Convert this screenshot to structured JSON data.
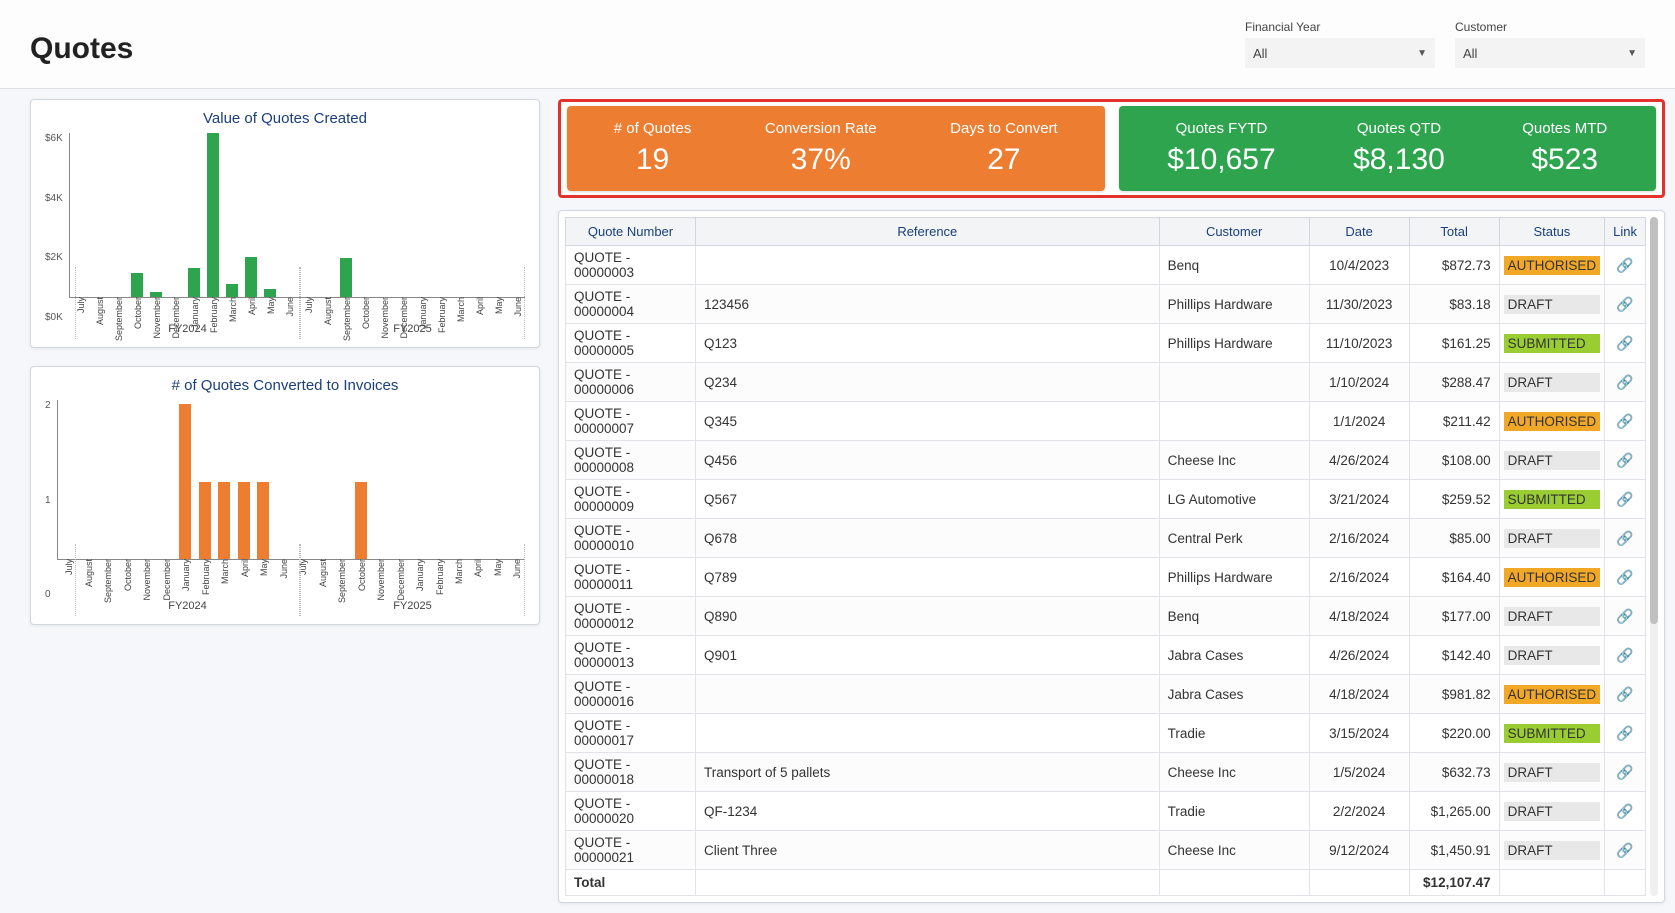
{
  "page_title": "Quotes",
  "filters": {
    "fy": {
      "label": "Financial Year",
      "value": "All"
    },
    "customer": {
      "label": "Customer",
      "value": "All"
    }
  },
  "kpi": {
    "orange": [
      {
        "label": "# of Quotes",
        "value": "19"
      },
      {
        "label": "Conversion Rate",
        "value": "37%"
      },
      {
        "label": "Days to Convert",
        "value": "27"
      }
    ],
    "green": [
      {
        "label": "Quotes FYTD",
        "value": "$10,657"
      },
      {
        "label": "Quotes QTD",
        "value": "$8,130"
      },
      {
        "label": "Quotes MTD",
        "value": "$523"
      }
    ]
  },
  "chart_data": [
    {
      "type": "bar",
      "title": "Value of Quotes Created",
      "ylabel": "",
      "ylim": [
        0,
        6000
      ],
      "y_ticks": [
        "$6K",
        "$4K",
        "$2K",
        "$0K"
      ],
      "groups": [
        "FY2024",
        "FY2025"
      ],
      "categories": [
        "July",
        "August",
        "September",
        "October",
        "November",
        "December",
        "January",
        "February",
        "March",
        "April",
        "May",
        "June"
      ],
      "series": [
        {
          "name": "FY2024",
          "color": "green",
          "values": [
            0,
            0,
            0,
            900,
            200,
            0,
            1100,
            6400,
            500,
            1500,
            300,
            0
          ]
        },
        {
          "name": "FY2025",
          "color": "green",
          "values": [
            0,
            0,
            1450,
            0,
            0,
            0,
            0,
            0,
            0,
            0,
            0,
            0
          ]
        }
      ]
    },
    {
      "type": "bar",
      "title": "# of Quotes Converted to Invoices",
      "ylabel": "",
      "ylim": [
        0,
        2
      ],
      "y_ticks": [
        "2",
        "1",
        "0"
      ],
      "groups": [
        "FY2024",
        "FY2025"
      ],
      "categories": [
        "July",
        "August",
        "September",
        "October",
        "November",
        "December",
        "January",
        "February",
        "March",
        "April",
        "May",
        "June"
      ],
      "series": [
        {
          "name": "FY2024",
          "color": "orange",
          "values": [
            0,
            0,
            0,
            0,
            0,
            0,
            2,
            1,
            1,
            1,
            1,
            0
          ]
        },
        {
          "name": "FY2025",
          "color": "orange",
          "values": [
            0,
            0,
            0,
            1,
            0,
            0,
            0,
            0,
            0,
            0,
            0,
            0
          ]
        }
      ]
    }
  ],
  "grid": {
    "columns": [
      "Quote Number",
      "Reference",
      "Customer",
      "Date",
      "Total",
      "Status",
      "Link"
    ],
    "rows": [
      {
        "qn": "QUOTE - 00000003",
        "ref": "",
        "cust": "Benq",
        "date": "10/4/2023",
        "total": "$872.73",
        "status": "AUTHORISED"
      },
      {
        "qn": "QUOTE - 00000004",
        "ref": "123456",
        "cust": "Phillips Hardware",
        "date": "11/30/2023",
        "total": "$83.18",
        "status": "DRAFT"
      },
      {
        "qn": "QUOTE - 00000005",
        "ref": "Q123",
        "cust": "Phillips Hardware",
        "date": "11/10/2023",
        "total": "$161.25",
        "status": "SUBMITTED"
      },
      {
        "qn": "QUOTE - 00000006",
        "ref": "Q234",
        "cust": "",
        "date": "1/10/2024",
        "total": "$288.47",
        "status": "DRAFT"
      },
      {
        "qn": "QUOTE - 00000007",
        "ref": "Q345",
        "cust": "",
        "date": "1/1/2024",
        "total": "$211.42",
        "status": "AUTHORISED"
      },
      {
        "qn": "QUOTE - 00000008",
        "ref": "Q456",
        "cust": "Cheese Inc",
        "date": "4/26/2024",
        "total": "$108.00",
        "status": "DRAFT"
      },
      {
        "qn": "QUOTE - 00000009",
        "ref": "Q567",
        "cust": "LG Automotive",
        "date": "3/21/2024",
        "total": "$259.52",
        "status": "SUBMITTED"
      },
      {
        "qn": "QUOTE - 00000010",
        "ref": "Q678",
        "cust": "Central Perk",
        "date": "2/16/2024",
        "total": "$85.00",
        "status": "DRAFT"
      },
      {
        "qn": "QUOTE - 00000011",
        "ref": "Q789",
        "cust": "Phillips Hardware",
        "date": "2/16/2024",
        "total": "$164.40",
        "status": "AUTHORISED"
      },
      {
        "qn": "QUOTE - 00000012",
        "ref": "Q890",
        "cust": "Benq",
        "date": "4/18/2024",
        "total": "$177.00",
        "status": "DRAFT"
      },
      {
        "qn": "QUOTE - 00000013",
        "ref": "Q901",
        "cust": "Jabra Cases",
        "date": "4/26/2024",
        "total": "$142.40",
        "status": "DRAFT"
      },
      {
        "qn": "QUOTE - 00000016",
        "ref": "",
        "cust": "Jabra Cases",
        "date": "4/18/2024",
        "total": "$981.82",
        "status": "AUTHORISED"
      },
      {
        "qn": "QUOTE - 00000017",
        "ref": "",
        "cust": "Tradie",
        "date": "3/15/2024",
        "total": "$220.00",
        "status": "SUBMITTED"
      },
      {
        "qn": "QUOTE - 00000018",
        "ref": "Transport of 5 pallets",
        "cust": "Cheese Inc",
        "date": "1/5/2024",
        "total": "$632.73",
        "status": "DRAFT"
      },
      {
        "qn": "QUOTE - 00000020",
        "ref": "QF-1234",
        "cust": "Tradie",
        "date": "2/2/2024",
        "total": "$1,265.00",
        "status": "DRAFT"
      },
      {
        "qn": "QUOTE - 00000021",
        "ref": "Client Three",
        "cust": "Cheese Inc",
        "date": "9/12/2024",
        "total": "$1,450.91",
        "status": "DRAFT"
      }
    ],
    "total_label": "Total",
    "total_value": "$12,107.47"
  }
}
